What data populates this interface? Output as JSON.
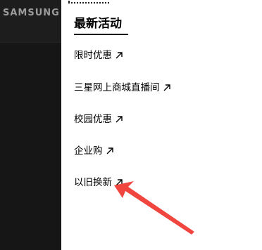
{
  "brand": {
    "text": "SAMSUNG"
  },
  "drawer": {
    "title": "最新活动",
    "items": [
      {
        "label": "限时优惠"
      },
      {
        "label": "三星网上商城直播间"
      },
      {
        "label": "校园优惠"
      },
      {
        "label": "企业购"
      },
      {
        "label": "以旧换新"
      }
    ]
  },
  "colors": {
    "panel_bg": "#ffffff",
    "backdrop": "#161616",
    "text": "#000000",
    "annotation_arrow": "#f0463f"
  },
  "icons": {
    "item_icon": "external-arrow-icon",
    "annotation": "red-pointer-arrow"
  }
}
